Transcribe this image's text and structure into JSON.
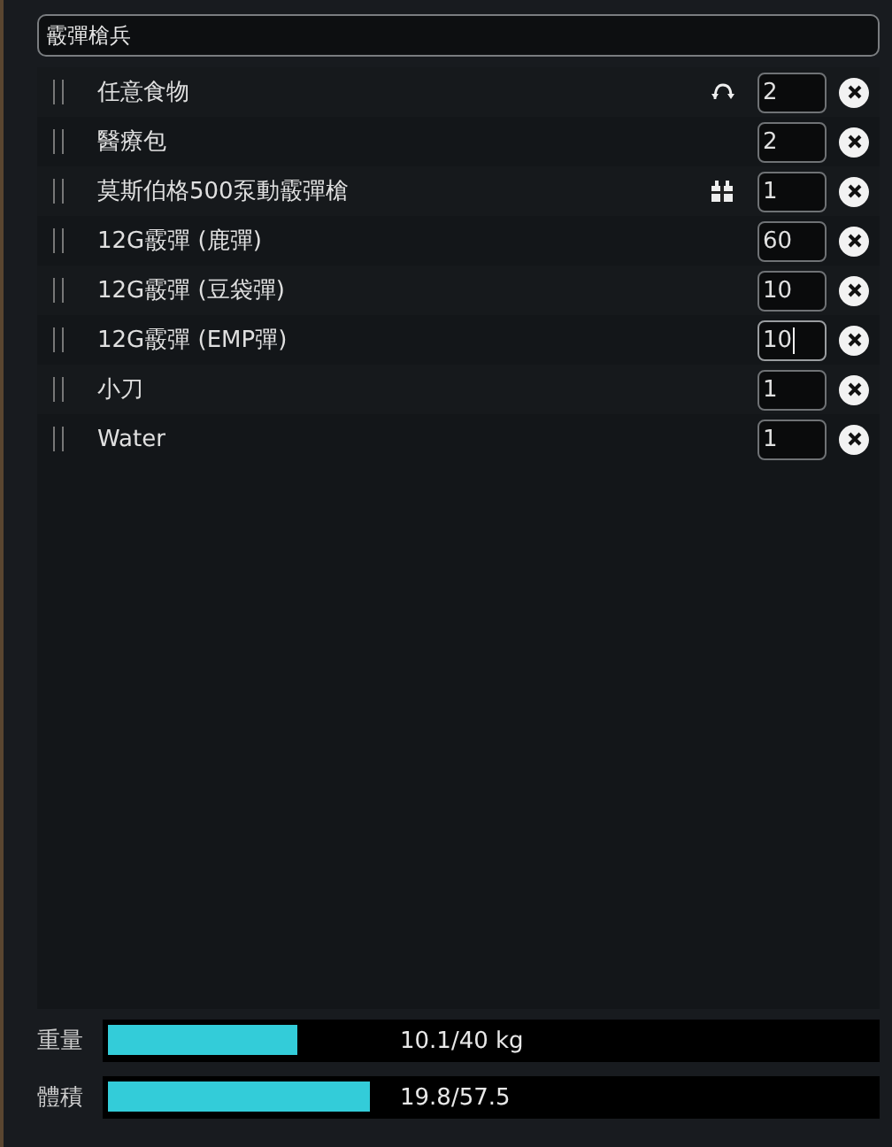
{
  "loadout_name": {
    "value": "霰彈槍兵"
  },
  "items": [
    {
      "name": "任意食物",
      "kind": "swap",
      "quantity": "2",
      "focused": false
    },
    {
      "name": "醫療包",
      "kind": "plain",
      "quantity": "2",
      "focused": false
    },
    {
      "name": "莫斯伯格500泵動霰彈槍",
      "kind": "pack",
      "quantity": "1",
      "focused": false
    },
    {
      "name": "12G霰彈 (鹿彈)",
      "kind": "plain",
      "quantity": "60",
      "focused": false
    },
    {
      "name": "12G霰彈 (豆袋彈)",
      "kind": "plain",
      "quantity": "10",
      "focused": false
    },
    {
      "name": "12G霰彈 (EMP彈)",
      "kind": "plain",
      "quantity": "10",
      "focused": true
    },
    {
      "name": "小刀",
      "kind": "plain",
      "quantity": "1",
      "focused": false
    },
    {
      "name": "Water",
      "kind": "plain",
      "quantity": "1",
      "focused": false
    }
  ],
  "meters": [
    {
      "label": "重量",
      "level": 0.25,
      "reading": "10.1/40 kg"
    },
    {
      "label": "體積",
      "level": 0.344,
      "reading": "19.8/57.5"
    }
  ]
}
